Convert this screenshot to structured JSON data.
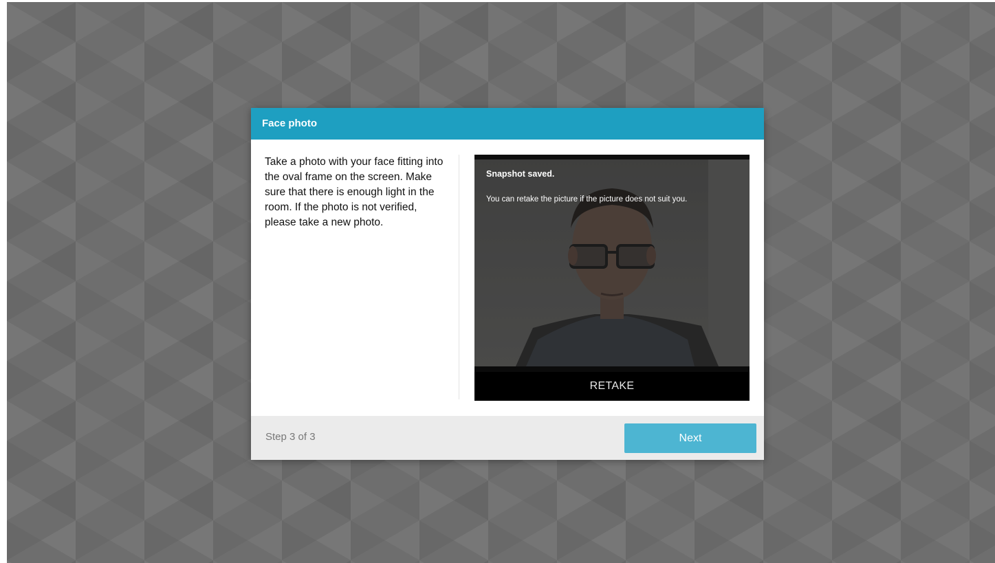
{
  "modal": {
    "title": "Face photo",
    "instructions": "Take a photo with your face fitting into the oval frame on the screen. Make sure that there is enough light in the room. If the photo is not verified, please take a new photo."
  },
  "camera": {
    "status_title": "Snapshot saved.",
    "status_message": "You can retake the picture if the picture does not suit you.",
    "retake_label": "RETAKE"
  },
  "footer": {
    "step_text": "Step 3 of 3",
    "next_label": "Next"
  },
  "colors": {
    "header": "#1e9fc1",
    "next_button": "#4db5d2",
    "backdrop": "#6e6e6e",
    "footer": "#ebebeb"
  }
}
